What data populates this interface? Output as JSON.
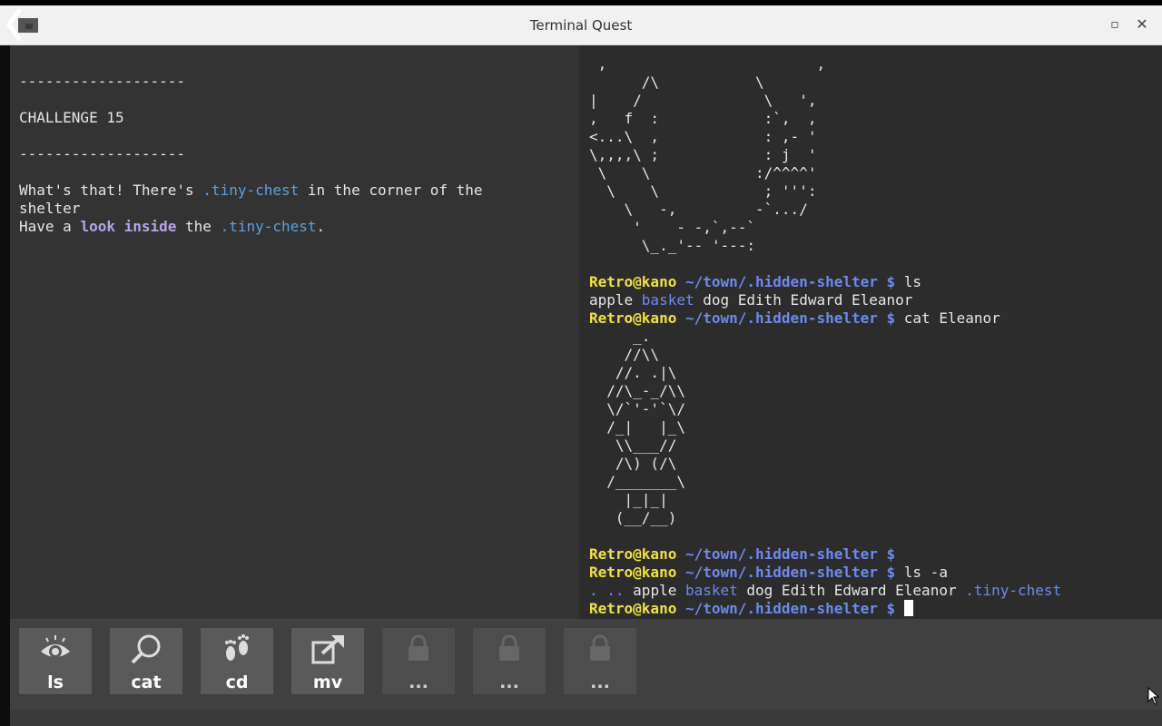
{
  "window": {
    "title": "Terminal Quest"
  },
  "story": {
    "separator": "-------------------",
    "challenge": "CHALLENGE 15",
    "line1_a": "What's that! There's ",
    "line1_b": ".tiny-chest",
    "line1_c": " in the corner of the",
    "line2": "shelter",
    "line3_a": "Have a ",
    "line3_b": "look",
    "line3_c": " ",
    "line3_d": "inside",
    "line3_e": " the ",
    "line3_f": ".tiny-chest",
    "line3_g": "."
  },
  "terminal": {
    "art1": " ,                        ,\n      /\\           \\\n|    /              \\   ',\n,   f  :            :`,  ,\n<...\\  ,            : ,- '\n\\,,,,\\ ;            : j  '\n \\    \\            :/^^^^'\n  \\    \\            ; ''':\n    \\   -,         -`.../\n     '    - -,`,--`\n      \\_._'-- '---:",
    "prompt_user": "Retro@kano",
    "prompt_path": " ~/town/.hidden-shelter $ ",
    "cmd1": "ls",
    "out1_a": "apple ",
    "out1_b": "basket",
    "out1_c": " dog Edith Edward Eleanor",
    "cmd2": "cat Eleanor",
    "art2": "     _.\n    //\\\\\n   //. .|\\\n  //\\_-_/\\\\\n  \\/`'-'`\\/\n  /_|   |_\\\n   \\\\___//\n   /\\) (/\\\n  /_______\\\n    |_|_|\n   (__/__)",
    "prompt_path_end": " ~/town/.hidden-shelter $",
    "cmd3": "ls -a",
    "out3_a": ". .. ",
    "out3_b": "apple ",
    "out3_c": "basket",
    "out3_d": " dog Edith Edward Eleanor ",
    "out3_e": ".tiny-chest"
  },
  "toolbar": {
    "tools": [
      {
        "label": "ls",
        "icon": "eye-icon",
        "locked": false
      },
      {
        "label": "cat",
        "icon": "magnifier-icon",
        "locked": false
      },
      {
        "label": "cd",
        "icon": "footprints-icon",
        "locked": false
      },
      {
        "label": "mv",
        "icon": "move-arrow-icon",
        "locked": false
      },
      {
        "label": "...",
        "icon": "lock-icon",
        "locked": true
      },
      {
        "label": "...",
        "icon": "lock-icon",
        "locked": true
      },
      {
        "label": "...",
        "icon": "lock-icon",
        "locked": true
      }
    ]
  },
  "colors": {
    "prompt_user": "#f0e23c",
    "prompt_path": "#6b8af0",
    "highlight": "#5aa0e6",
    "keyword": "#b6a3ee"
  }
}
